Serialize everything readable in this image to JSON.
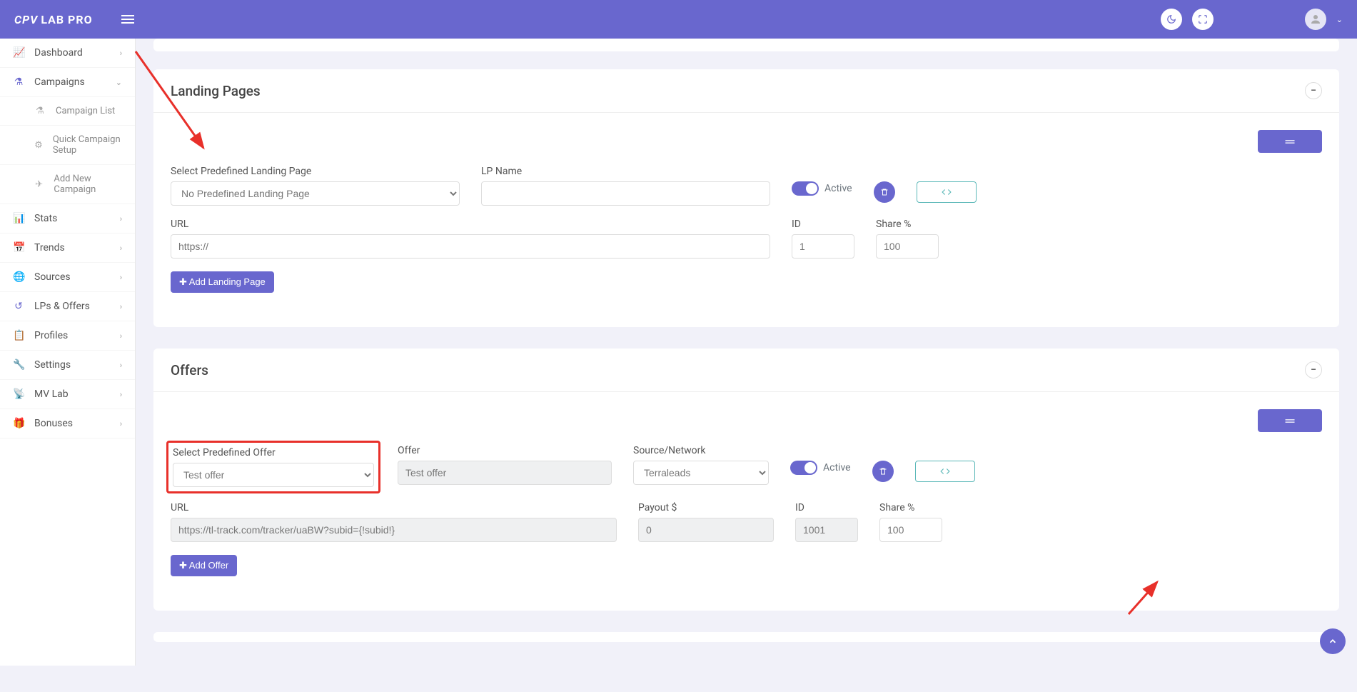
{
  "header": {
    "logo_main": "CPV",
    "logo_sub": "LAB PRO"
  },
  "sidebar": {
    "items": [
      {
        "icon": "📈",
        "label": "Dashboard",
        "chev": "›"
      },
      {
        "icon": "⚗",
        "label": "Campaigns",
        "chev": "⌄"
      },
      {
        "icon": "⚗",
        "label": "Campaign List",
        "sub": true
      },
      {
        "icon": "⚙",
        "label": "Quick Campaign Setup",
        "sub": true
      },
      {
        "icon": "✈",
        "label": "Add New Campaign",
        "sub": true
      },
      {
        "icon": "📊",
        "label": "Stats",
        "chev": "›"
      },
      {
        "icon": "📅",
        "label": "Trends",
        "chev": "›"
      },
      {
        "icon": "🌐",
        "label": "Sources",
        "chev": "›"
      },
      {
        "icon": "↺",
        "label": "LPs & Offers",
        "chev": "›"
      },
      {
        "icon": "📋",
        "label": "Profiles",
        "chev": "›"
      },
      {
        "icon": "🔧",
        "label": "Settings",
        "chev": "›"
      },
      {
        "icon": "📡",
        "label": "MV Lab",
        "chev": "›"
      },
      {
        "icon": "🎁",
        "label": "Bonuses",
        "chev": "›"
      }
    ]
  },
  "landing": {
    "title": "Landing Pages",
    "select_label": "Select Predefined Landing Page",
    "select_value": "No Predefined Landing Page",
    "name_label": "LP Name",
    "name_value": "",
    "active_label": "Active",
    "url_label": "URL",
    "url_placeholder": "https://",
    "url_value": "",
    "id_label": "ID",
    "id_value": "1",
    "share_label": "Share %",
    "share_value": "100",
    "add_label": "Add Landing Page"
  },
  "offers": {
    "title": "Offers",
    "select_label": "Select Predefined Offer",
    "select_value": "Test offer",
    "offer_label": "Offer",
    "offer_value": "Test offer",
    "source_label": "Source/Network",
    "source_value": "Terraleads",
    "active_label": "Active",
    "url_label": "URL",
    "url_value": "https://tl-track.com/tracker/uaBW?subid={!subid!}",
    "payout_label": "Payout $",
    "payout_value": "0",
    "id_label": "ID",
    "id_value": "1001",
    "share_label": "Share %",
    "share_value": "100",
    "add_label": "Add Offer"
  }
}
